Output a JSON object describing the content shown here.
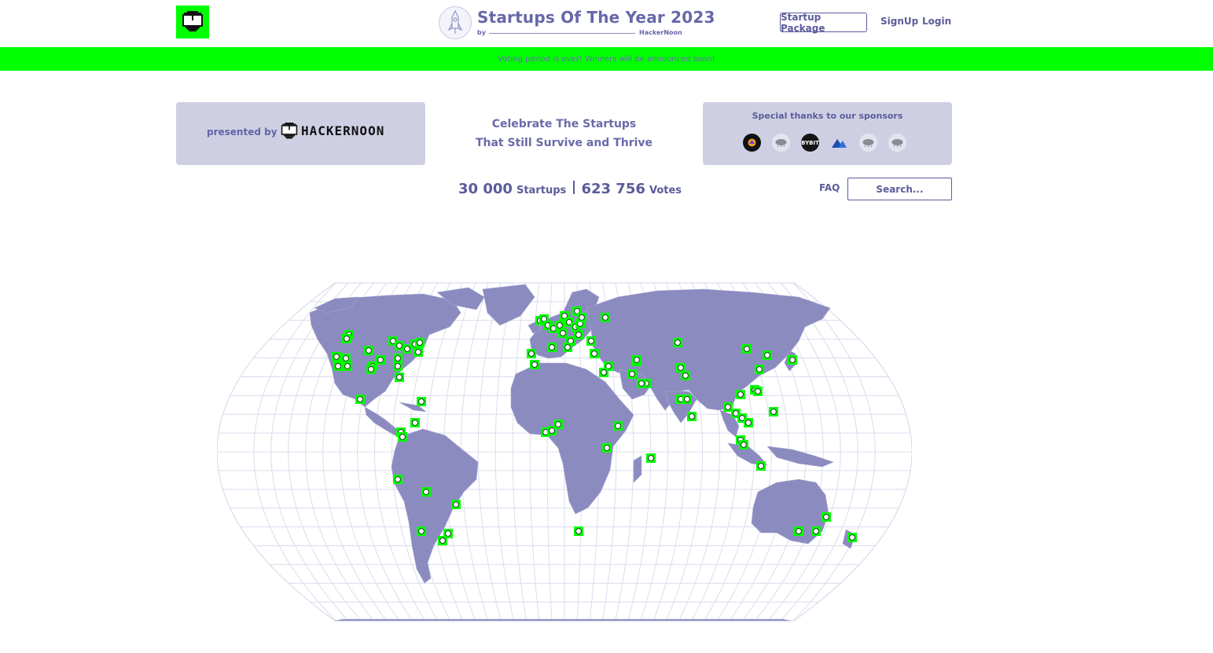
{
  "header": {
    "logo_icon": "hackernoon-pixel-head-icon",
    "title": "Startups Of The Year 2023",
    "by": "by",
    "by_brand": "HackerNoon",
    "startup_package": "Startup Package",
    "signup": "SignUp",
    "login": "Login"
  },
  "banner": {
    "text": "Voting period is over! Winners will be announced soon!",
    "color": "#00ff00"
  },
  "presented": {
    "label": "presented by",
    "brand": "HACKERNOON"
  },
  "tagline": {
    "line1": "Celebrate The Startups",
    "line2": "That Still Survive and Thrive"
  },
  "sponsors": {
    "title": "Special thanks to our sponsors",
    "logos": [
      "sponsor-logo-1",
      "sponsor-logo-2",
      "BYBIT",
      "sponsor-logo-4",
      "sponsor-logo-5",
      "sponsor-logo-6"
    ],
    "bybit": "BYBIT"
  },
  "stats": {
    "startups_count": "30 000",
    "startups_label": "Startups",
    "votes_count": "623 756",
    "votes_label": "Votes"
  },
  "faq": "FAQ",
  "search": {
    "placeholder": "Search..."
  },
  "map": {
    "land_color": "#8b8bc0",
    "pin_color": "#00ff00",
    "pin_icon": "hackernoon-pin-icon"
  },
  "colors": {
    "accent": "#5b5b9b",
    "panel": "#cfcfe4",
    "brand_green": "#00ff00"
  }
}
